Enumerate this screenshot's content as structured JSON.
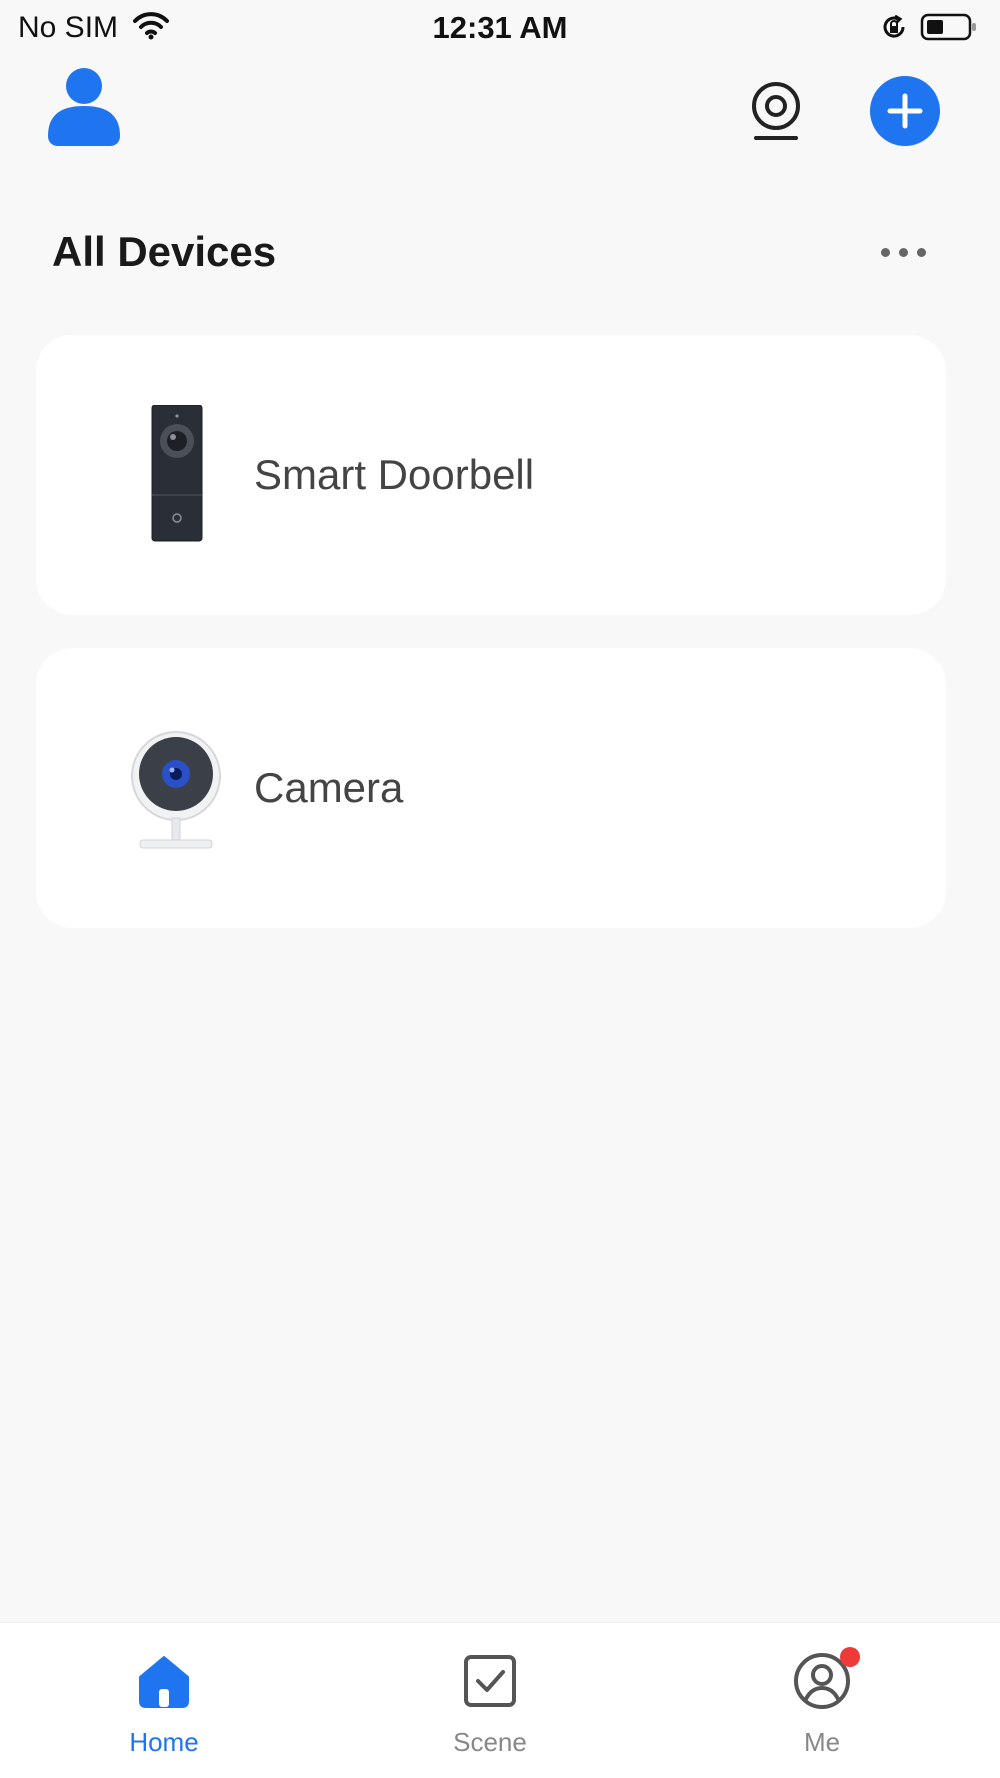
{
  "status_bar": {
    "carrier": "No SIM",
    "time": "12:31 AM",
    "icons": [
      "wifi-icon",
      "rotation-lock-icon",
      "battery-icon"
    ]
  },
  "header": {
    "icons": [
      "avatar-icon",
      "camera-icon",
      "add-icon"
    ],
    "accent_color": "#1f75f0"
  },
  "section": {
    "title": "All Devices",
    "more_icon": "more-dots-icon"
  },
  "devices": [
    {
      "name": "Smart Doorbell",
      "icon": "doorbell-icon"
    },
    {
      "name": "Camera",
      "icon": "camera-device-icon"
    }
  ],
  "tabs": [
    {
      "label": "Home",
      "icon": "home-icon",
      "active": true
    },
    {
      "label": "Scene",
      "icon": "scene-checkbox-icon",
      "active": false
    },
    {
      "label": "Me",
      "icon": "profile-icon",
      "active": false,
      "badge_color": "#f03a3a"
    }
  ]
}
